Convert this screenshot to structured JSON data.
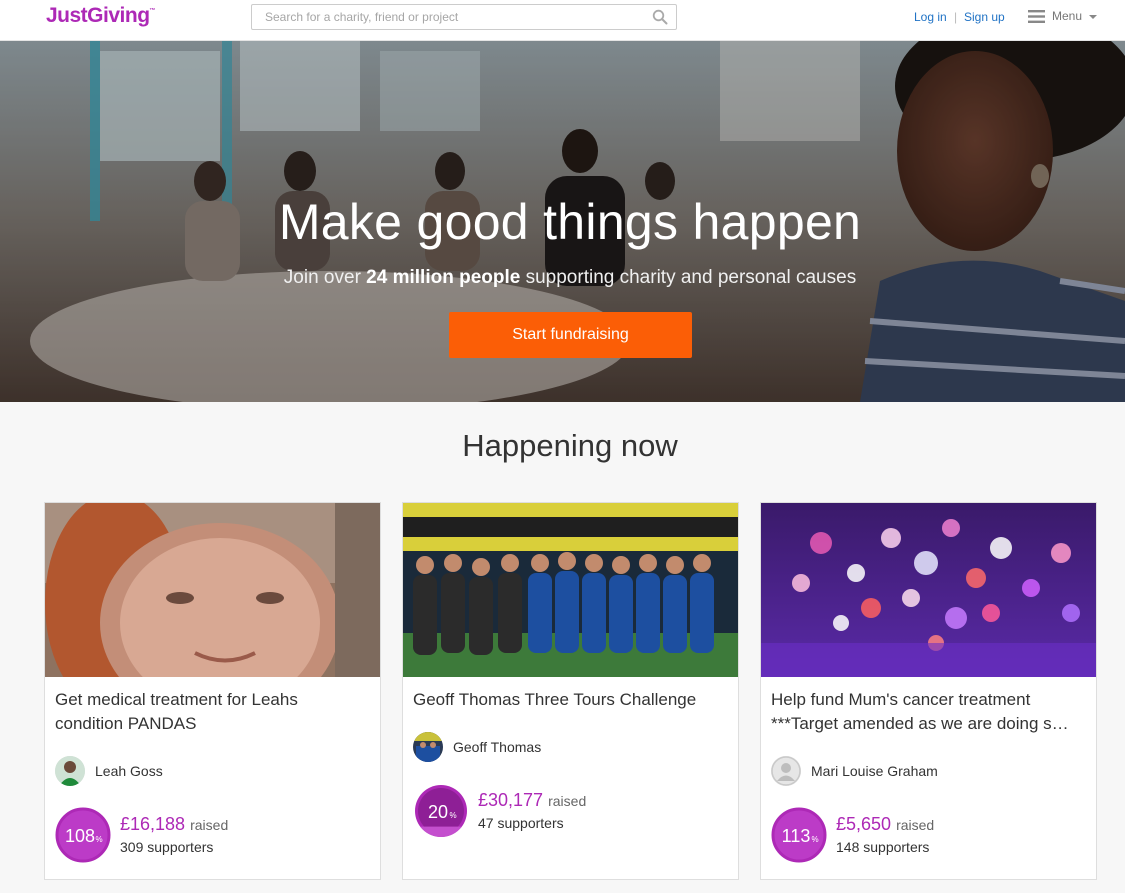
{
  "header": {
    "logo": "JustGiving",
    "logo_tm": "™",
    "search_placeholder": "Search for a charity, friend or project",
    "login": "Log in",
    "separator": "|",
    "signup": "Sign up",
    "menu": "Menu"
  },
  "hero": {
    "title": "Make good things happen",
    "subtitle_pre": "Join over ",
    "subtitle_strong": "24 million people",
    "subtitle_post": " supporting charity and personal causes",
    "cta": "Start fundraising"
  },
  "section": {
    "title": "Happening now"
  },
  "cards": [
    {
      "title_line1": "Get medical treatment for Leahs",
      "title_line2": "condition PANDAS",
      "owner": "Leah Goss",
      "percent": "108",
      "percent_value": 1.08,
      "amount": "£16,188",
      "raised_label": "raised",
      "supporters": "309 supporters"
    },
    {
      "title_line1": "Geoff Thomas Three Tours Challenge",
      "owner": "Geoff Thomas",
      "percent": "20",
      "percent_value": 0.2,
      "amount": "£30,177",
      "raised_label": "raised",
      "supporters": "47 supporters"
    },
    {
      "title_line1": "Help fund Mum's cancer treatment",
      "title_line2": "***Target amended as we are doing s…",
      "owner": "Mari Louise Graham",
      "percent": "113",
      "percent_value": 1.13,
      "amount": "£5,650",
      "raised_label": "raised",
      "supporters": "148 supporters"
    }
  ],
  "percent_sign": "%",
  "colors": {
    "brand": "#ad29b6",
    "cta": "#fb5e06",
    "link": "#2173c5"
  }
}
